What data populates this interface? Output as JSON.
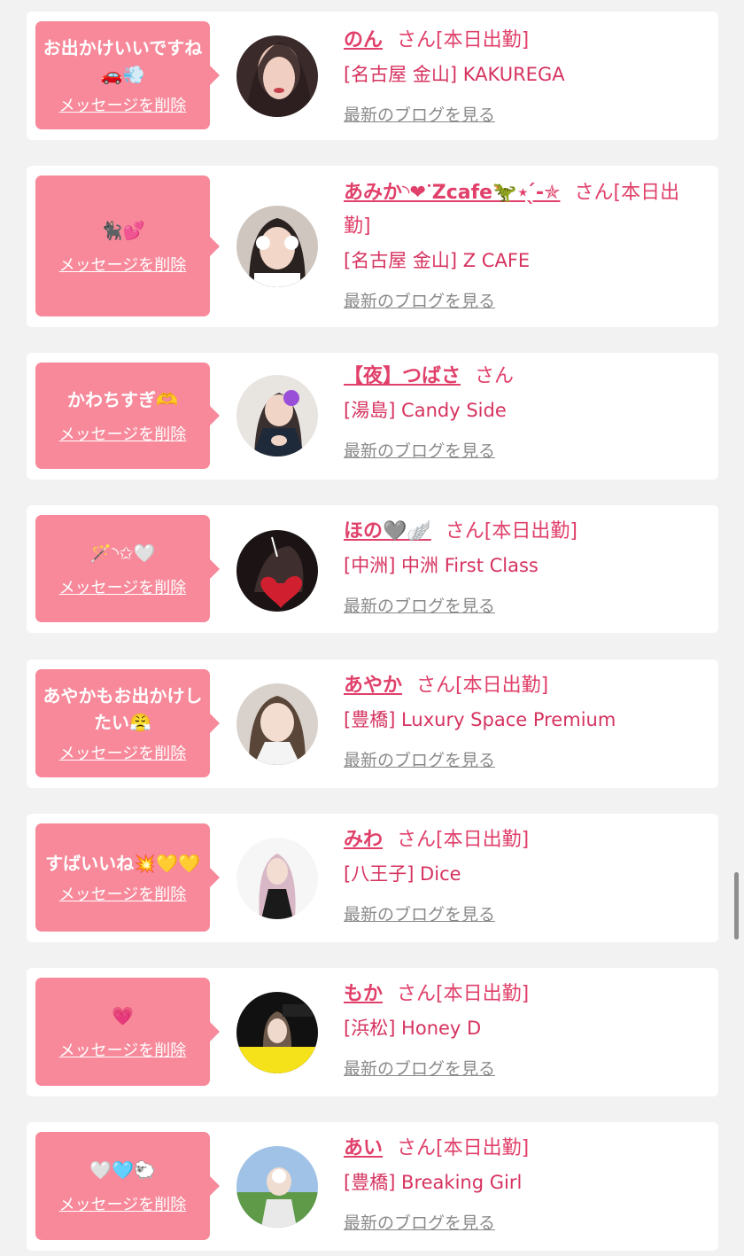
{
  "common": {
    "delete_label": "メッセージを削除",
    "blog_label": "最新のブログを見る"
  },
  "colors": {
    "bubble": "#f7899a",
    "name": "#e0406a",
    "shop": "#d6335f",
    "card": "#ffffff",
    "page_bg": "#f2f2f2"
  },
  "items": [
    {
      "message": "お出かけいいですね🚗💨",
      "name": "のん",
      "suffix": "さん[本日出勤]",
      "shop": "[名古屋 金山] KAKUREGA"
    },
    {
      "message": "🐈‍⬛💕",
      "name": "あみか◝❤︎ᐝZcafe🦖⋆ ̖́-✯",
      "suffix": "さん[本日出勤]",
      "shop": "[名古屋 金山] Z CAFE"
    },
    {
      "message": "かわちすぎ🫶",
      "name": "【夜】つばさ",
      "suffix": "さん",
      "shop": "[湯島] Candy Side"
    },
    {
      "message": "🪄◝✩🤍",
      "name": "ほの🩶🪽",
      "suffix": "さん[本日出勤]",
      "shop": "[中洲] 中洲 First Class"
    },
    {
      "message": "あやかもお出かけしたい😤",
      "name": "あやか",
      "suffix": "さん[本日出勤]",
      "shop": "[豊橋] Luxury Space Premium"
    },
    {
      "message": "すばいいね💥💛💛",
      "name": "みわ",
      "suffix": "さん[本日出勤]",
      "shop": "[八王子] Dice"
    },
    {
      "message": "💗",
      "name": "もか",
      "suffix": "さん[本日出勤]",
      "shop": "[浜松] Honey D"
    },
    {
      "message": "🤍🩵🐑",
      "name": "あい",
      "suffix": "さん[本日出勤]",
      "shop": "[豊橋] Breaking Girl"
    }
  ]
}
